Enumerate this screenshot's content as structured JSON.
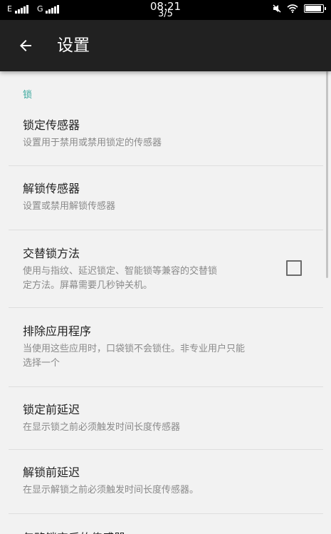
{
  "status_bar": {
    "network_1": "E",
    "network_2": "G",
    "time": "08:21",
    "page_indicator": "3/5"
  },
  "app_bar": {
    "back_icon": "arrow-back-icon",
    "title": "设置"
  },
  "section": {
    "header": "锁"
  },
  "items": [
    {
      "title": "锁定传感器",
      "summary": "设置用于禁用或禁用锁定的传感器"
    },
    {
      "title": "解锁传感器",
      "summary": "设置或禁用解锁传感器"
    },
    {
      "title": "交替锁方法",
      "summary_line1": "使用与指纹、延迟锁定、智能锁等兼容的交替锁",
      "summary_line2": "定方法。屏幕需要几秒钟关机。",
      "checked": false
    },
    {
      "title": "排除应用程序",
      "summary_line1": "当使用这些应用时，口袋锁不会锁住。非专业用户只能",
      "summary_line2": "选择一个"
    },
    {
      "title": "锁定前延迟",
      "summary": "在显示锁之前必须触发时间长度传感器"
    },
    {
      "title": "解锁前延迟",
      "summary": "在显示解锁之前必须触发时间长度传感器。"
    },
    {
      "title": "忽略锁定后的传感器。"
    }
  ],
  "colors": {
    "status_bar": "#000000",
    "app_bar": "#212121",
    "background": "#f2f2f2",
    "accent": "#3aa89d"
  }
}
